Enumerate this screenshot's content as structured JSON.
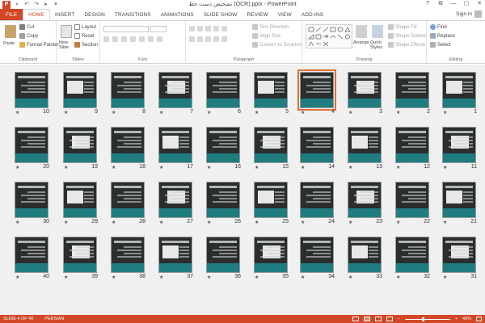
{
  "app": {
    "title": "تشخیص دست خط (OCR).pptx - PowerPoint",
    "logo_letter": "P",
    "signin": "Sign in",
    "brand_color": "#d24726"
  },
  "window_controls": [
    "?",
    "⧉",
    "—",
    "▢",
    "✕"
  ],
  "tabs": [
    "FILE",
    "HOME",
    "INSERT",
    "DESIGN",
    "TRANSITIONS",
    "ANIMATIONS",
    "SLIDE SHOW",
    "REVIEW",
    "VIEW",
    "ADD-INS"
  ],
  "active_tab": "HOME",
  "ribbon": {
    "clipboard": {
      "label": "Clipboard",
      "paste": "Paste",
      "cut": "Cut",
      "copy": "Copy",
      "format_painter": "Format Painter"
    },
    "slides": {
      "label": "Slides",
      "new_slide": "New Slide",
      "layout": "Layout",
      "reset": "Reset",
      "section": "Section"
    },
    "font": {
      "label": "Font"
    },
    "paragraph": {
      "label": "Paragraph",
      "text_direction": "Text Direction",
      "align_text": "Align Text",
      "convert_smartart": "Convert to SmartArt"
    },
    "drawing": {
      "label": "Drawing",
      "arrange": "Arrange",
      "quick_styles": "Quick Styles",
      "shape_fill": "Shape Fill",
      "shape_outline": "Shape Outline",
      "shape_effects": "Shape Effects"
    },
    "editing": {
      "label": "Editing",
      "find": "Find",
      "replace": "Replace",
      "select": "Select"
    }
  },
  "slides": [
    {
      "n": "10"
    },
    {
      "n": "9"
    },
    {
      "n": "8"
    },
    {
      "n": "7"
    },
    {
      "n": "6"
    },
    {
      "n": "5"
    },
    {
      "n": "4",
      "selected": true
    },
    {
      "n": "3"
    },
    {
      "n": "2"
    },
    {
      "n": "1"
    },
    {
      "n": "20"
    },
    {
      "n": "19"
    },
    {
      "n": "18"
    },
    {
      "n": "17"
    },
    {
      "n": "16"
    },
    {
      "n": "15"
    },
    {
      "n": "14"
    },
    {
      "n": "13"
    },
    {
      "n": "12"
    },
    {
      "n": "11"
    },
    {
      "n": "30"
    },
    {
      "n": "29"
    },
    {
      "n": "28"
    },
    {
      "n": "27"
    },
    {
      "n": "26"
    },
    {
      "n": "25"
    },
    {
      "n": "24"
    },
    {
      "n": "23"
    },
    {
      "n": "22"
    },
    {
      "n": "21"
    },
    {
      "n": "40"
    },
    {
      "n": "39"
    },
    {
      "n": "38"
    },
    {
      "n": "37"
    },
    {
      "n": "36"
    },
    {
      "n": "35"
    },
    {
      "n": "34"
    },
    {
      "n": "33"
    },
    {
      "n": "32"
    },
    {
      "n": "31"
    }
  ],
  "slide_star": "★",
  "status": {
    "slide_info": "SLIDE 4 OF 40",
    "language": "PERSIAN",
    "zoom": "40%",
    "zoom_fraction": 0.4
  }
}
